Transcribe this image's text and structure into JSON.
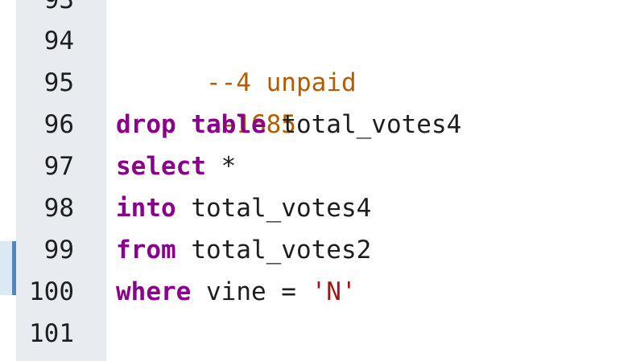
{
  "editor": {
    "colors": {
      "gutter_bg": "#e8ecf1",
      "comment": "#b25e00",
      "keyword": "#8a008a",
      "string": "#a31515",
      "plain": "#1e1e1e",
      "change_marker": "#4a88c7"
    },
    "lines": [
      {
        "number": "93",
        "tokens": []
      },
      {
        "number": "94",
        "tokens": [
          {
            "type": "comment",
            "text": "--4 unpaid"
          }
        ]
      },
      {
        "number": "95",
        "tokens": [
          {
            "type": "comment",
            "text": "--1685"
          }
        ]
      },
      {
        "number": "96",
        "tokens": [
          {
            "type": "keyword",
            "text": "drop"
          },
          {
            "type": "plain",
            "text": " "
          },
          {
            "type": "keyword",
            "text": "table"
          },
          {
            "type": "plain",
            "text": " total_votes4"
          }
        ]
      },
      {
        "number": "97",
        "tokens": [
          {
            "type": "keyword",
            "text": "select"
          },
          {
            "type": "plain",
            "text": " *"
          }
        ]
      },
      {
        "number": "98",
        "tokens": [
          {
            "type": "keyword",
            "text": "into"
          },
          {
            "type": "plain",
            "text": " total_votes4"
          }
        ]
      },
      {
        "number": "99",
        "tokens": [
          {
            "type": "keyword",
            "text": "from"
          },
          {
            "type": "plain",
            "text": " total_votes2"
          }
        ]
      },
      {
        "number": "100",
        "tokens": [
          {
            "type": "keyword",
            "text": "where"
          },
          {
            "type": "plain",
            "text": " vine = "
          },
          {
            "type": "string",
            "text": "'N'"
          }
        ]
      },
      {
        "number": "101",
        "tokens": []
      }
    ]
  }
}
